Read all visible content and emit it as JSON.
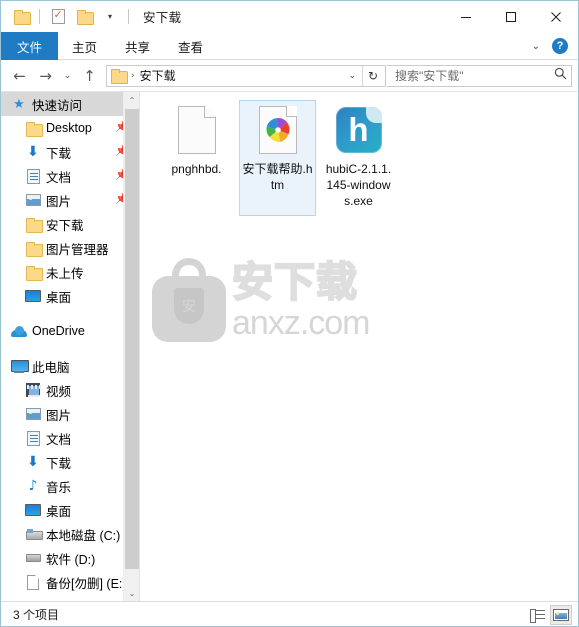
{
  "window": {
    "title": "安下载",
    "quick_access_toolbar": [
      {
        "name": "folder-properties-icon",
        "label": "属性"
      },
      {
        "name": "new-folder-icon",
        "label": "新建文件夹"
      },
      {
        "name": "customize-qat-caret",
        "label": "▾"
      }
    ],
    "controls": {
      "minimize": "最小化",
      "maximize": "最大化",
      "close": "关闭"
    }
  },
  "ribbon": {
    "tabs": [
      {
        "label": "文件",
        "active": true
      },
      {
        "label": "主页",
        "active": false
      },
      {
        "label": "共享",
        "active": false
      },
      {
        "label": "查看",
        "active": false
      }
    ],
    "collapse_caret": "⌄",
    "help_label": "?"
  },
  "navigation": {
    "back": "←",
    "forward": "→",
    "recent": "⌄",
    "up": "↑",
    "address": {
      "crumb": "安下载",
      "separator": "›",
      "dropdown": "⌄",
      "refresh": "↻"
    },
    "search": {
      "placeholder": "搜索\"安下载\"",
      "icon": "search-icon"
    }
  },
  "sidebar": {
    "groups": [
      {
        "header": {
          "label": "快速访问",
          "icon": "pin-star-icon",
          "selected": true
        },
        "items": [
          {
            "label": "Desktop",
            "icon": "folder-icon",
            "pinned": true
          },
          {
            "label": "下载",
            "icon": "download-arrow-icon",
            "pinned": true
          },
          {
            "label": "文档",
            "icon": "document-icon",
            "pinned": true
          },
          {
            "label": "图片",
            "icon": "picture-icon",
            "pinned": true
          },
          {
            "label": "安下载",
            "icon": "folder-icon",
            "pinned": false
          },
          {
            "label": "图片管理器",
            "icon": "folder-icon",
            "pinned": false
          },
          {
            "label": "未上传",
            "icon": "folder-icon",
            "pinned": false
          },
          {
            "label": "桌面",
            "icon": "desktop-icon",
            "pinned": false
          }
        ]
      },
      {
        "header": {
          "label": "OneDrive",
          "icon": "cloud-icon",
          "selected": false
        },
        "items": []
      },
      {
        "header": {
          "label": "此电脑",
          "icon": "computer-icon",
          "selected": false
        },
        "items": [
          {
            "label": "视频",
            "icon": "video-icon",
            "pinned": false
          },
          {
            "label": "图片",
            "icon": "picture-icon",
            "pinned": false
          },
          {
            "label": "文档",
            "icon": "document-icon",
            "pinned": false
          },
          {
            "label": "下载",
            "icon": "download-arrow-icon",
            "pinned": false
          },
          {
            "label": "音乐",
            "icon": "music-note-icon",
            "pinned": false
          },
          {
            "label": "桌面",
            "icon": "desktop-icon",
            "pinned": false
          },
          {
            "label": "本地磁盘 (C:)",
            "icon": "system-drive-icon",
            "pinned": false
          },
          {
            "label": "软件 (D:)",
            "icon": "drive-icon",
            "pinned": false
          },
          {
            "label": "备份[勿删] (E:)",
            "icon": "page-icon",
            "pinned": false
          }
        ]
      }
    ],
    "scrollbar": {
      "up": "⌃",
      "down": "⌄"
    }
  },
  "files": [
    {
      "name": "pnghhbd.",
      "icon": "blank-document-icon",
      "selected": false
    },
    {
      "name": "安下载帮助.htm",
      "icon": "html-document-icon",
      "selected": true
    },
    {
      "name": "hubiC-2.1.1.145-windows.exe",
      "icon": "hubic-app-icon",
      "selected": false
    }
  ],
  "watermark": {
    "shield_char": "安",
    "text_cn": "安下载",
    "text_en": "anxz.com"
  },
  "statusbar": {
    "item_count": "3 个项目",
    "views": [
      {
        "name": "details-view-button",
        "active": false
      },
      {
        "name": "large-icons-view-button",
        "active": true
      }
    ]
  },
  "colors": {
    "accent": "#1f7cc4",
    "selection": "#eaf3fb",
    "folder": "#fcd988",
    "window_border": "#9bc4d6"
  }
}
